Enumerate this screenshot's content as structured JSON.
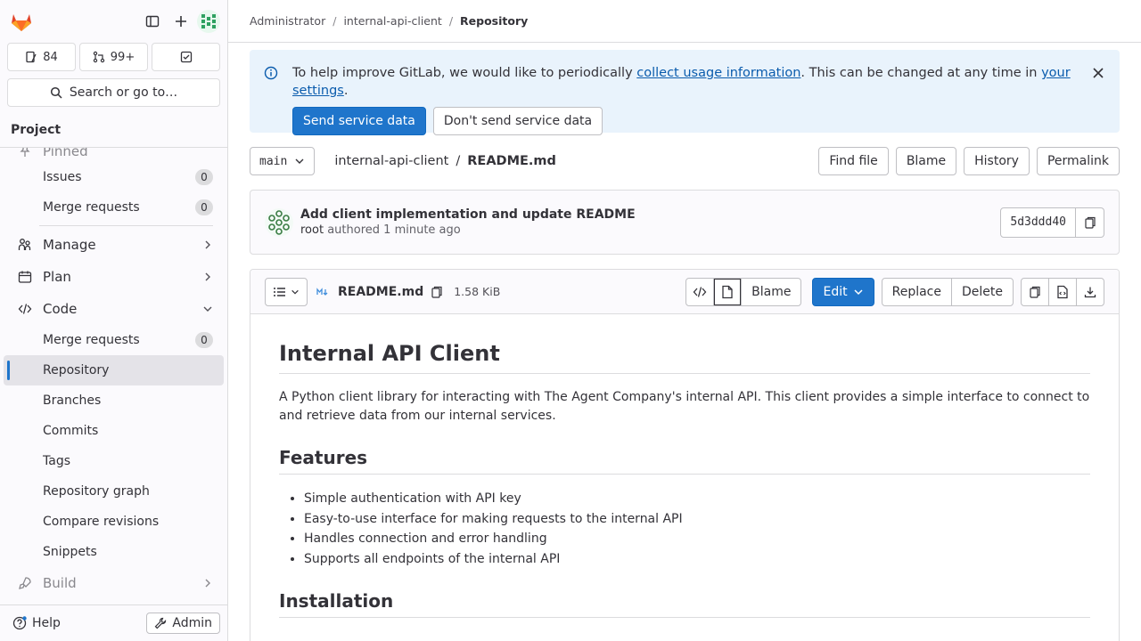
{
  "sidebar": {
    "counts": [
      {
        "label": "84"
      },
      {
        "label": "99+"
      },
      {
        "label": ""
      }
    ],
    "search_label": "Search or go to…",
    "section_title": "Project",
    "pinned_label": "Pinned",
    "pinned_items": [
      {
        "label": "Issues",
        "count": "0"
      },
      {
        "label": "Merge requests",
        "count": "0"
      }
    ],
    "groups": {
      "manage": "Manage",
      "plan": "Plan",
      "code": "Code",
      "build": "Build"
    },
    "code_items": [
      {
        "label": "Merge requests",
        "count": "0"
      },
      {
        "label": "Repository"
      },
      {
        "label": "Branches"
      },
      {
        "label": "Commits"
      },
      {
        "label": "Tags"
      },
      {
        "label": "Repository graph"
      },
      {
        "label": "Compare revisions"
      },
      {
        "label": "Snippets"
      }
    ],
    "help_label": "Help",
    "admin_label": "Admin"
  },
  "breadcrumb": {
    "items": [
      "Administrator",
      "internal-api-client",
      "Repository"
    ]
  },
  "banner": {
    "text_before": "To help improve GitLab, we would like to periodically ",
    "link1": "collect usage information",
    "text_middle": ". This can be changed at any time in ",
    "link2": "your settings",
    "text_after": ".",
    "primary_button": "Send service data",
    "secondary_button": "Don't send service data"
  },
  "filebar": {
    "branch": "main",
    "project": "internal-api-client",
    "separator": "/",
    "file": "README.md",
    "buttons": [
      "Find file",
      "Blame",
      "History",
      "Permalink"
    ]
  },
  "commit": {
    "message": "Add client implementation and update README",
    "author": "root",
    "authored": "authored",
    "time": "1 minute ago",
    "sha": "5d3ddd40"
  },
  "blob": {
    "filename": "README.md",
    "size": "1.58 KiB",
    "blame_label": "Blame",
    "edit_label": "Edit",
    "replace_label": "Replace",
    "delete_label": "Delete"
  },
  "readme": {
    "h1": "Internal API Client",
    "intro": "A Python client library for interacting with The Agent Company's internal API. This client provides a simple interface to connect to and retrieve data from our internal services.",
    "features_heading": "Features",
    "features": [
      "Simple authentication with API key",
      "Easy-to-use interface for making requests to the internal API",
      "Handles connection and error handling",
      "Supports all endpoints of the internal API"
    ],
    "installation_heading": "Installation"
  },
  "colors": {
    "accent": "#1f75cb",
    "banner_bg": "#e9f3fc",
    "logo_orange": "#e24329"
  }
}
